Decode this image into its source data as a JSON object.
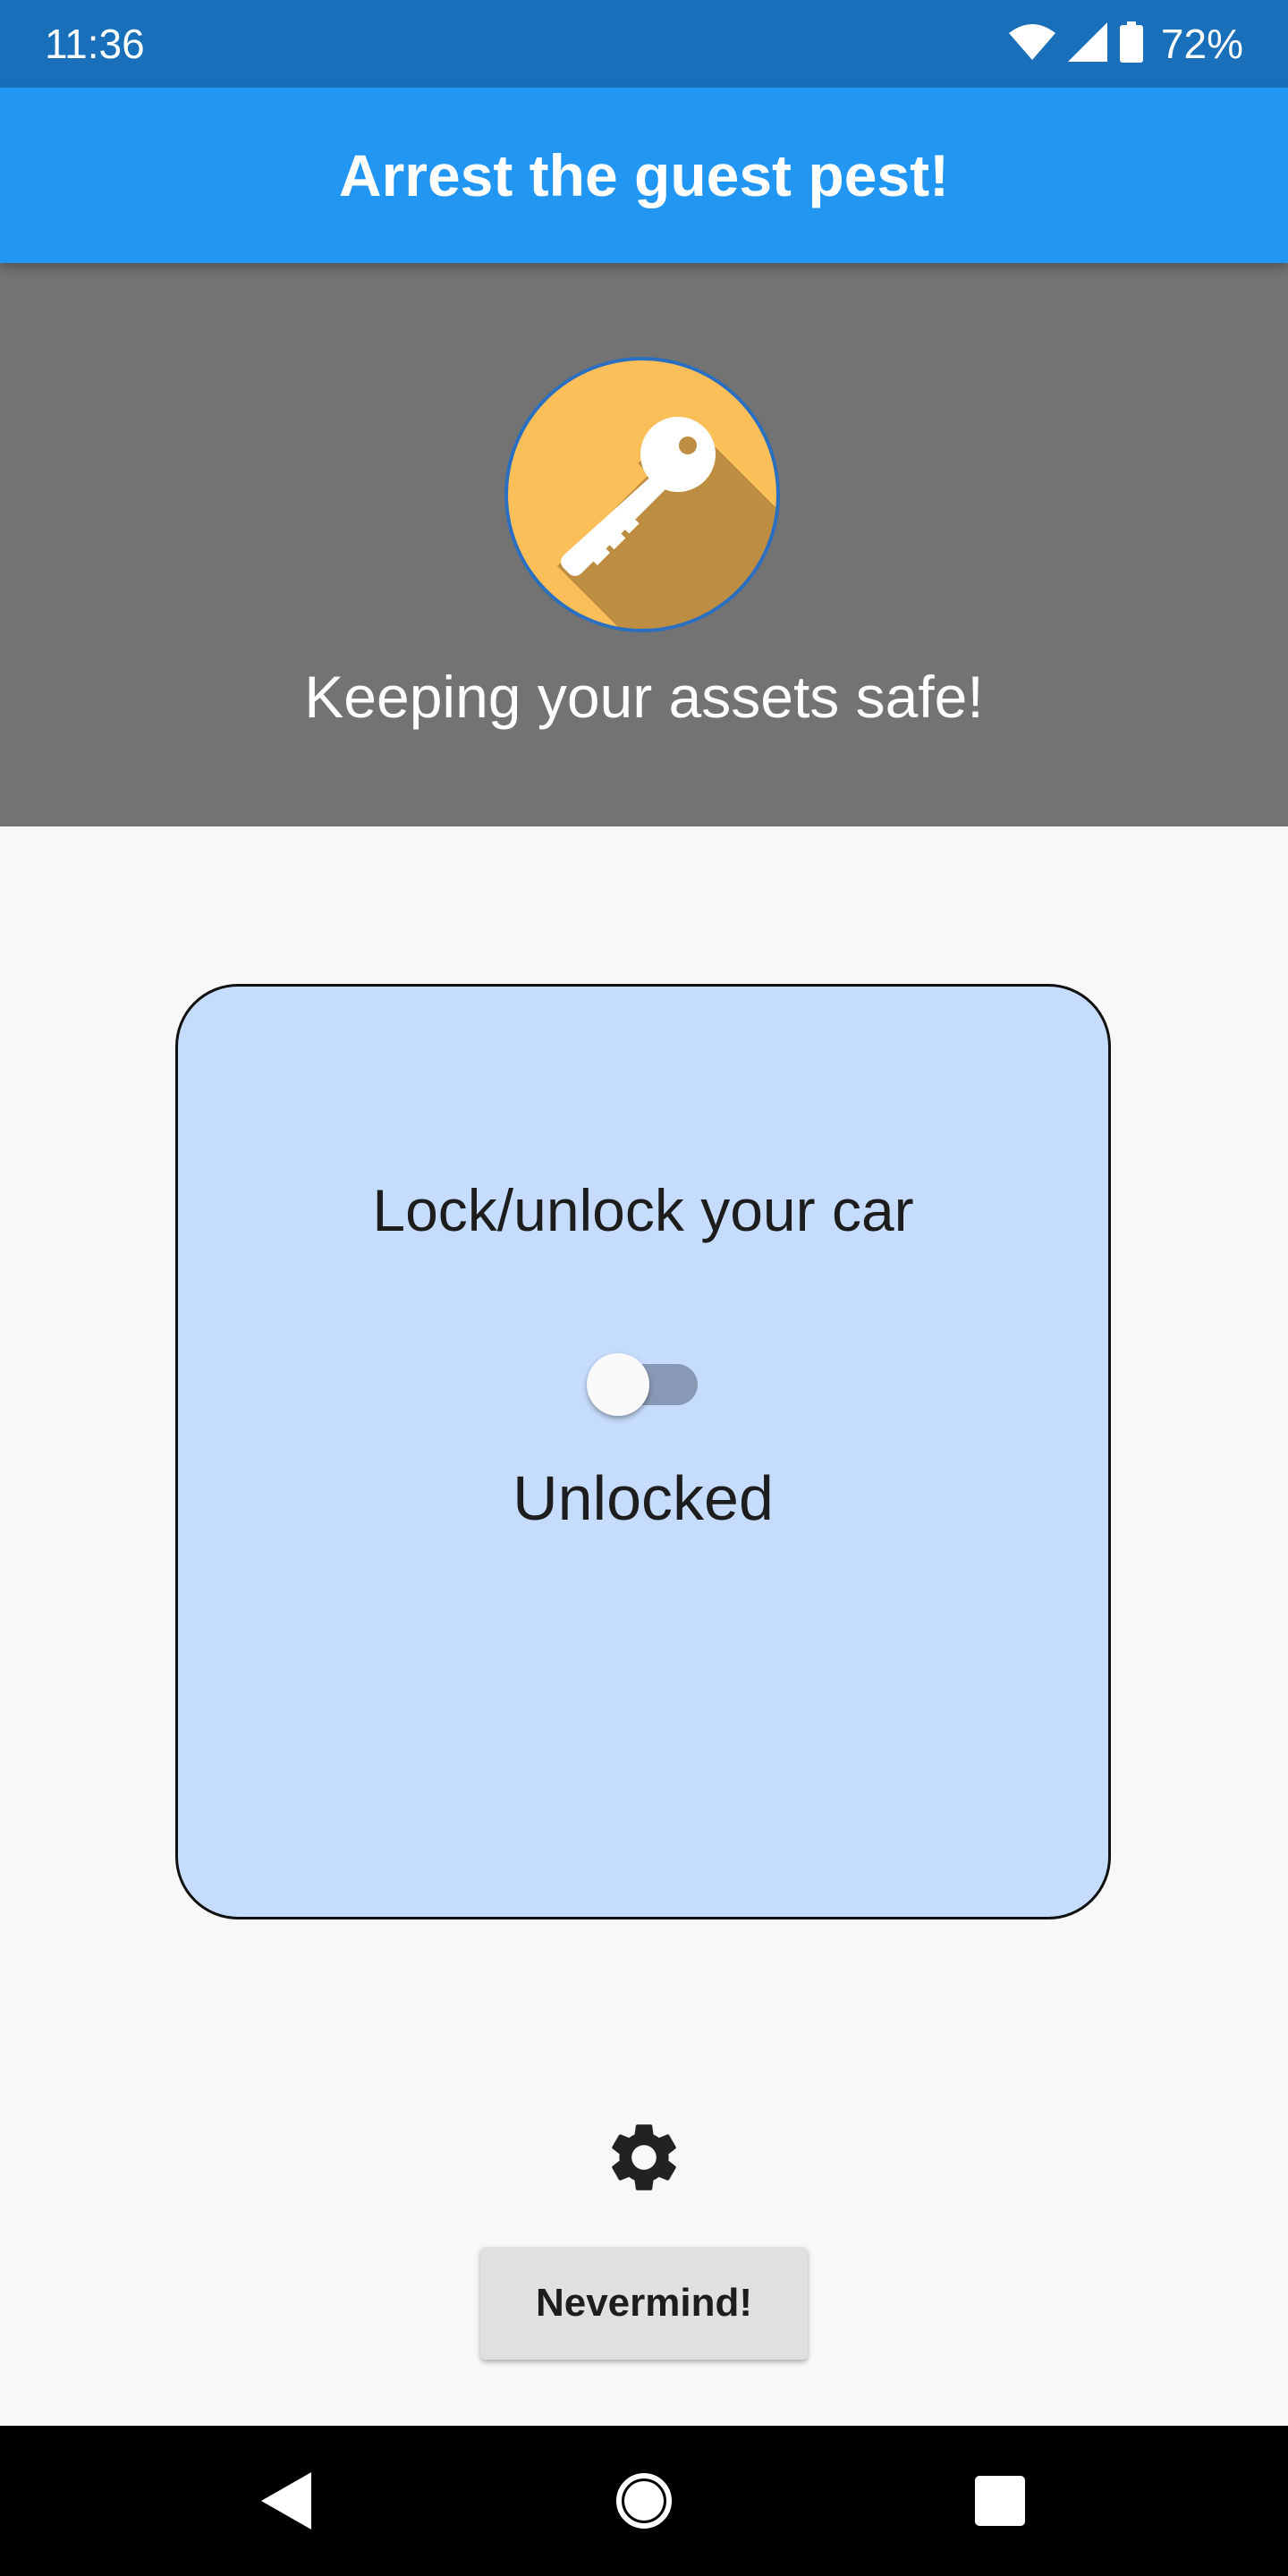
{
  "status_bar": {
    "time": "11:36",
    "battery_percent": "72%",
    "icons": [
      "wifi-icon",
      "cell-signal-icon",
      "battery-icon"
    ]
  },
  "app_bar": {
    "title": "Arrest the guest pest!",
    "color": "#2196f3"
  },
  "hero": {
    "logo_icon": "key-icon",
    "caption": "Keeping your assets safe!"
  },
  "card": {
    "title": "Lock/unlock your car",
    "toggle_on": false,
    "status": "Unlocked"
  },
  "actions": {
    "settings_icon": "gear-icon",
    "nevermind_label": "Nevermind!"
  },
  "nav_bar": {
    "icons": [
      "back-icon",
      "home-icon",
      "recents-icon"
    ]
  }
}
